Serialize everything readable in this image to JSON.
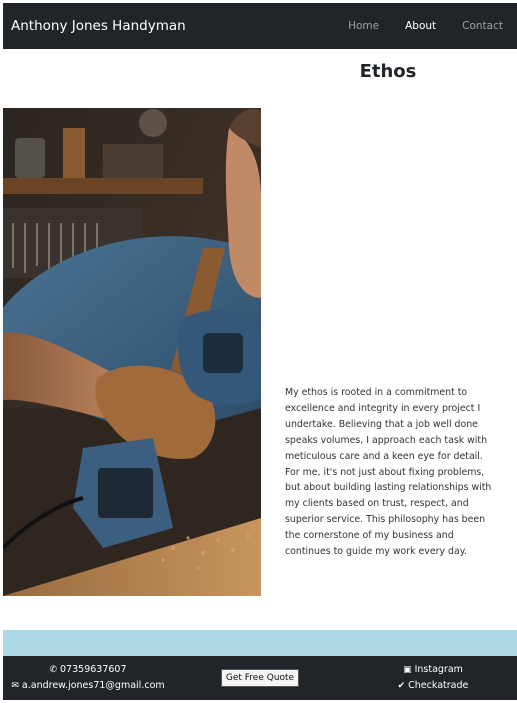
{
  "nav": {
    "brand": "Anthony Jones Handyman",
    "links": [
      {
        "label": "Home",
        "active": false
      },
      {
        "label": "About",
        "active": true
      },
      {
        "label": "Contact",
        "active": false
      }
    ]
  },
  "main": {
    "title": "Ethos",
    "paragraph": "My ethos is rooted in a commitment to excellence and integrity in every project I undertake. Believing that a job well done speaks volumes, I approach each task with meticulous care and a keen eye for detail. For me, it's not just about fixing problems, but about building lasting relationships with my clients based on trust, respect, and superior service. This philosophy has been the cornerstone of my business and continues to guide my work every day."
  },
  "footer": {
    "phone": "07359637607",
    "email": "a.andrew.jones71@gmail.com",
    "quote_button": "Get Free Quote",
    "instagram": "Instagram",
    "checkatrade": "Checkatrade"
  },
  "colors": {
    "navbar_bg": "#212529",
    "band": "#add8e6",
    "footer_bg": "#212529"
  },
  "icons": {
    "phone": "phone-icon",
    "email": "envelope-icon",
    "instagram": "instagram-icon",
    "checkatrade": "check-circle-icon"
  }
}
